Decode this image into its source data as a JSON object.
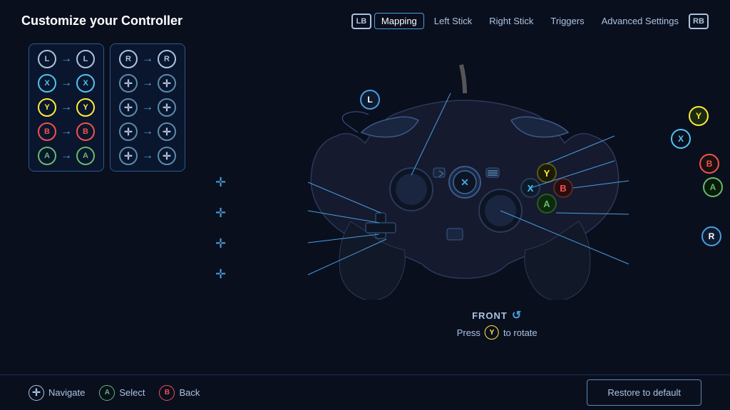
{
  "header": {
    "title": "Customize your Controller",
    "lb_label": "LB",
    "rb_label": "RB",
    "tabs": [
      {
        "id": "mapping",
        "label": "Mapping",
        "active": true
      },
      {
        "id": "left-stick",
        "label": "Left Stick",
        "active": false
      },
      {
        "id": "right-stick",
        "label": "Right Stick",
        "active": false
      },
      {
        "id": "triggers",
        "label": "Triggers",
        "active": false
      },
      {
        "id": "advanced-settings",
        "label": "Advanced Settings",
        "active": false
      }
    ]
  },
  "mapping": {
    "left_column": [
      {
        "from": "L",
        "to": "L"
      },
      {
        "from": "X",
        "to": "X"
      },
      {
        "from": "Y",
        "to": "Y"
      },
      {
        "from": "B",
        "to": "B"
      },
      {
        "from": "A",
        "to": "A"
      }
    ],
    "right_column": [
      {
        "from": "R",
        "to": "R"
      },
      {
        "from": "✛",
        "to": "✛"
      },
      {
        "from": "✛",
        "to": "✛"
      },
      {
        "from": "✛",
        "to": "✛"
      },
      {
        "from": "✛",
        "to": "✛"
      }
    ]
  },
  "controller": {
    "front_label": "FRONT",
    "press_text": "Press",
    "y_button": "Y",
    "rotate_text": "to rotate"
  },
  "bottom": {
    "hints": [
      {
        "icon": "✛",
        "type": "dpad",
        "label": "Navigate"
      },
      {
        "icon": "A",
        "type": "a",
        "label": "Select"
      },
      {
        "icon": "B",
        "type": "b",
        "label": "Back"
      }
    ],
    "restore_button": "Restore to default"
  }
}
